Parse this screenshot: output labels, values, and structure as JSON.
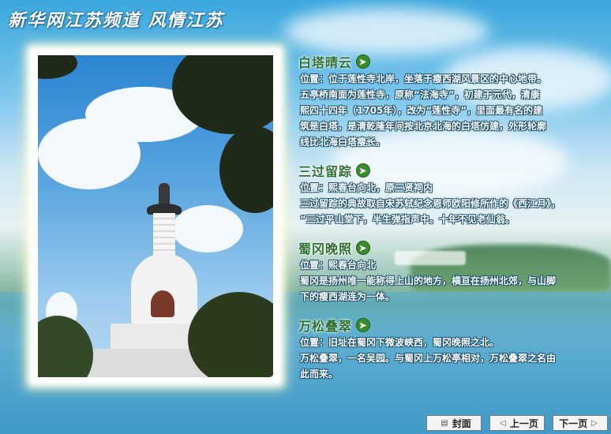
{
  "header": {
    "title": "新华网江苏频道  风情江苏"
  },
  "sections": [
    {
      "title": "白塔晴云",
      "lines": [
        "位置：位于莲性寺北岸，坐落于瘦西湖风景区的中心地带。",
        "五亭桥南面为莲性寺，原称“法海寺”，初建于元代，清康",
        "熙四十四年（1705年），改为“莲性寺”，里面最有名的建",
        "筑是白塔，是清乾隆年间按北京北海的白塔仿建，外形轮廓",
        "线比北海白塔瘦长。"
      ]
    },
    {
      "title": "三过留踪",
      "lines": [
        "位置：熙春台向北，原三贤祠内",
        "三过留踪的典故取自宋苏轼纪念恩师欧阳修所作的《西江月》，",
        "“三过平山堂下，半生弹指声中。十年不见老仙翁。"
      ]
    },
    {
      "title": "蜀冈晚照",
      "lines": [
        "位置：熙春台向北",
        "蜀冈是扬州唯一能称得上山的地方，横亘在扬州北郊，与山脚",
        "下的瘦西湖连为一体。"
      ]
    },
    {
      "title": "万松叠翠",
      "lines": [
        "位置：旧址在蜀冈下微波峡西，蜀冈晚照之北。",
        "万松叠翠，一名吴园。与蜀冈上万松亭相对，万松叠翠之名由",
        "此而来。"
      ]
    }
  ],
  "nav": {
    "cover": "封面",
    "prev": "上一页",
    "next": "下一页"
  },
  "icons": {
    "go": "arrow-right-circle-icon",
    "cover": "document-icon",
    "prev": "chevron-left-icon",
    "next": "chevron-right-icon"
  },
  "colors": {
    "section_title": "#2f6f2f",
    "arrow_green": "#3a8d2e",
    "body_text": "#ffffff"
  }
}
